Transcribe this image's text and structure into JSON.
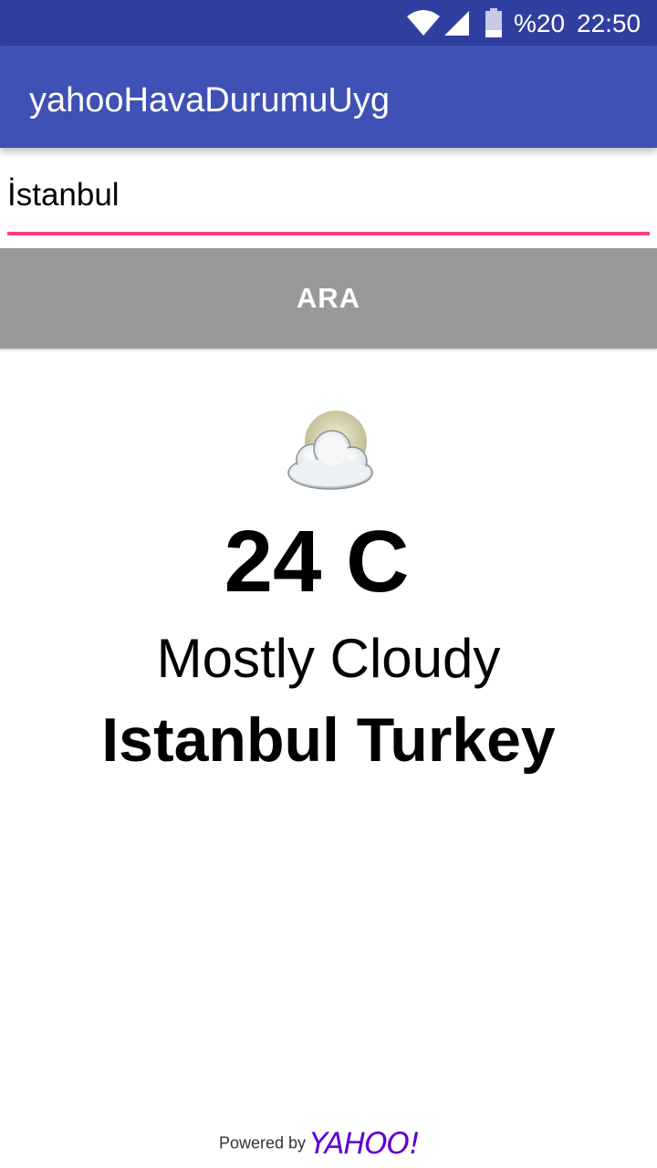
{
  "status_bar": {
    "battery": "%20",
    "time": "22:50",
    "icons": [
      "wifi-icon",
      "signal-icon",
      "battery-icon"
    ]
  },
  "app_bar": {
    "title": "yahooHavaDurumuUyg"
  },
  "search": {
    "value": "İstanbul",
    "button_label": "ARA"
  },
  "weather": {
    "icon": "mostly-cloudy-icon",
    "temperature": "24 C",
    "condition": "Mostly Cloudy",
    "location": "Istanbul Turkey"
  },
  "footer": {
    "powered_by": "Powered by",
    "brand": "YAHOO!"
  },
  "colors": {
    "status_bar": "#303f9f",
    "app_bar": "#3f51b5",
    "input_underline": "#ff4081",
    "button": "#999999",
    "yahoo_purple": "#5f01d1"
  }
}
